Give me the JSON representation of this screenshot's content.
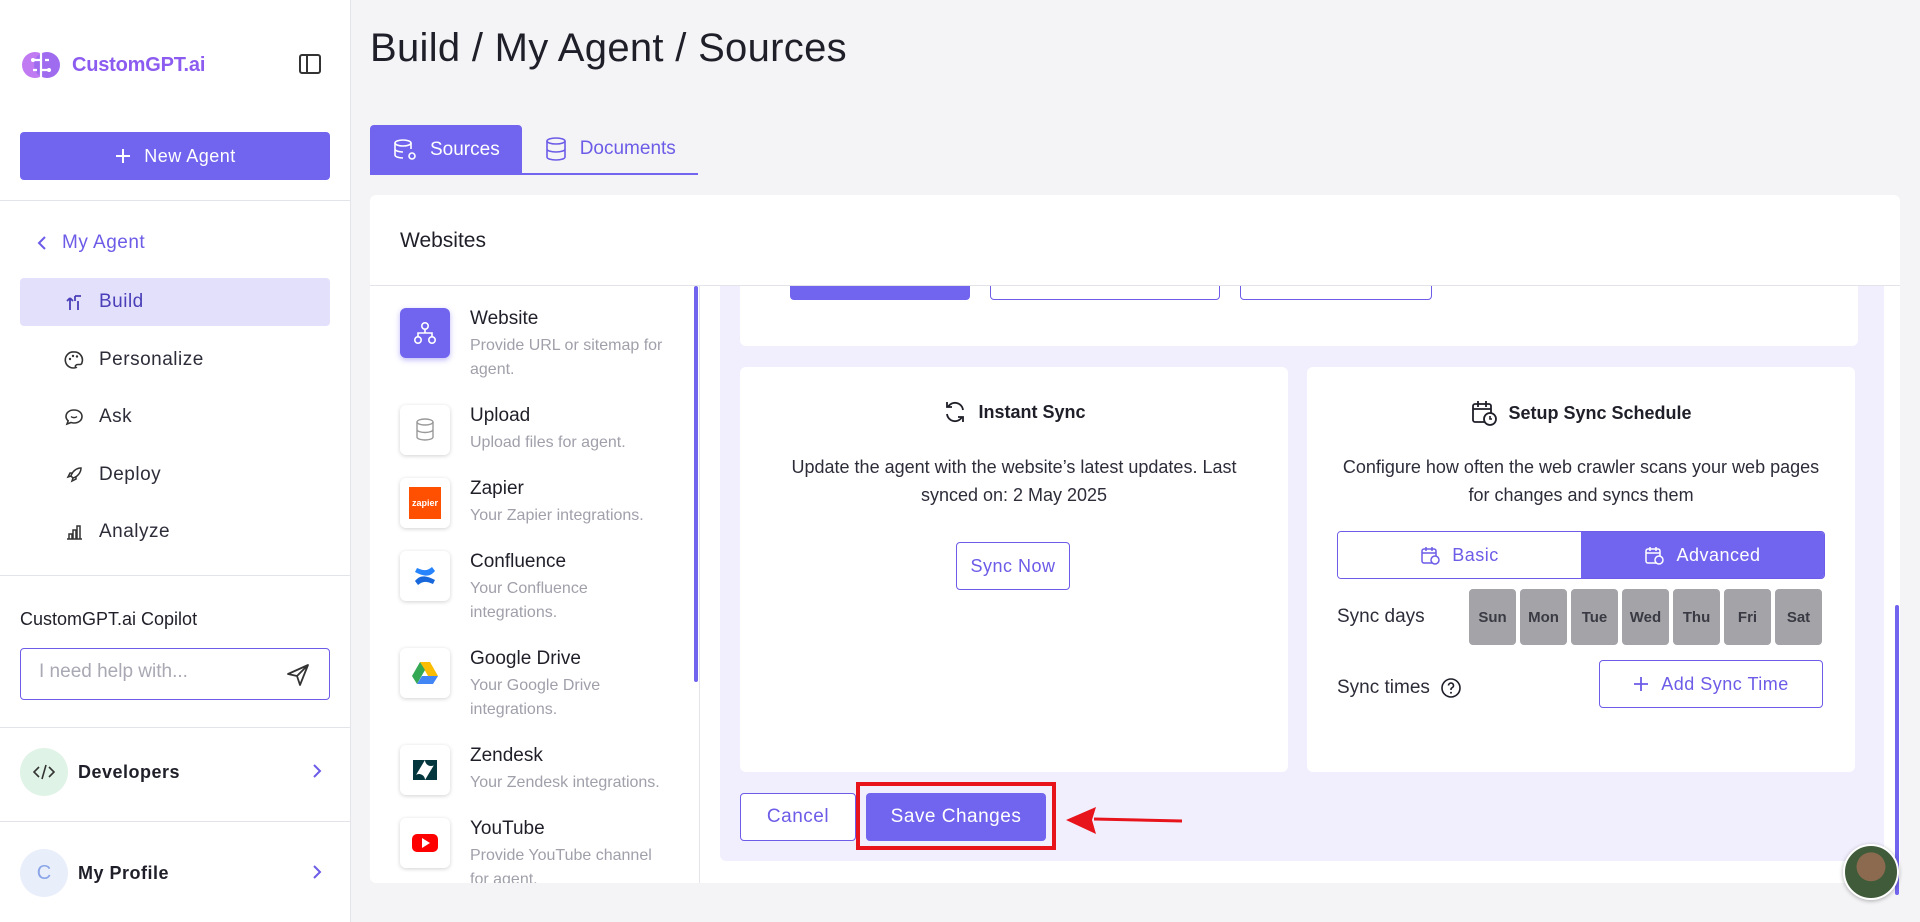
{
  "app": {
    "brand": "CustomGPT.ai",
    "accent": "#7164ee"
  },
  "sidebar": {
    "new_agent_label": "New Agent",
    "back_label": "My Agent",
    "items": [
      {
        "label": "Build",
        "icon": "build-icon",
        "active": true
      },
      {
        "label": "Personalize",
        "icon": "palette-icon",
        "active": false
      },
      {
        "label": "Ask",
        "icon": "chat-icon",
        "active": false
      },
      {
        "label": "Deploy",
        "icon": "rocket-icon",
        "active": false
      },
      {
        "label": "Analyze",
        "icon": "bar-chart-icon",
        "active": false
      }
    ],
    "copilot": {
      "title": "CustomGPT.ai Copilot",
      "placeholder": "I need help with..."
    },
    "developers_label": "Developers",
    "profile": {
      "initial": "C",
      "label": "My Profile"
    }
  },
  "header": {
    "title": "Build / My Agent / Sources"
  },
  "tabs": [
    {
      "label": "Sources",
      "active": true
    },
    {
      "label": "Documents",
      "active": false
    }
  ],
  "panel": {
    "title": "Websites"
  },
  "sources": [
    {
      "name": "Website",
      "desc": "Provide URL or sitemap for agent.",
      "icon": "sitemap-icon",
      "selected": true
    },
    {
      "name": "Upload",
      "desc": "Upload files for agent.",
      "icon": "database-icon",
      "selected": false
    },
    {
      "name": "Zapier",
      "desc": "Your Zapier integrations.",
      "icon": "zapier-icon",
      "selected": false
    },
    {
      "name": "Confluence",
      "desc": "Your Confluence integrations.",
      "icon": "confluence-icon",
      "selected": false
    },
    {
      "name": "Google Drive",
      "desc": "Your Google Drive integrations.",
      "icon": "google-drive-icon",
      "selected": false
    },
    {
      "name": "Zendesk",
      "desc": "Your Zendesk integrations.",
      "icon": "zendesk-icon",
      "selected": false
    },
    {
      "name": "YouTube",
      "desc": "Provide YouTube channel for agent.",
      "icon": "youtube-icon",
      "selected": false
    }
  ],
  "instant_sync": {
    "title": "Instant Sync",
    "text": "Update the agent with the website’s latest updates. Last synced on: 2 May 2025",
    "button": "Sync Now"
  },
  "schedule": {
    "title": "Setup Sync Schedule",
    "text": "Configure how often the web crawler scans your web pages for changes and syncs them",
    "modes": [
      {
        "label": "Basic",
        "active": false
      },
      {
        "label": "Advanced",
        "active": true
      }
    ],
    "days_label": "Sync days",
    "days": [
      "Sun",
      "Mon",
      "Tue",
      "Wed",
      "Thu",
      "Fri",
      "Sat"
    ],
    "times_label": "Sync times",
    "add_time_label": "Add Sync Time"
  },
  "actions": {
    "cancel": "Cancel",
    "save": "Save Changes"
  },
  "colors": {
    "highlight": "#e8141c"
  }
}
